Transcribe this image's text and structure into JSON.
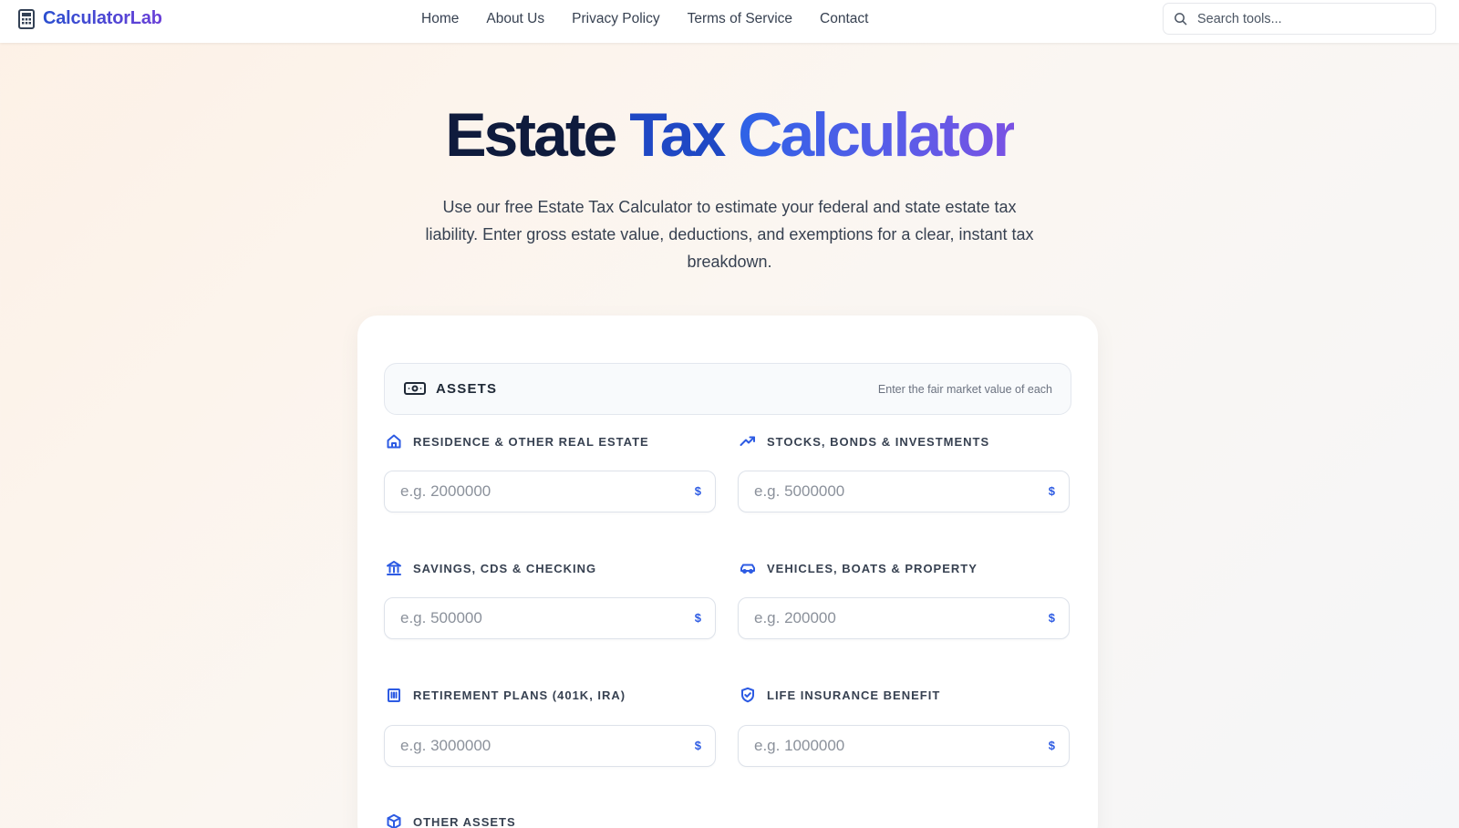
{
  "brand": {
    "name": "CalculatorLab",
    "logo_icon": "calculator-icon"
  },
  "nav": {
    "items": [
      {
        "label": "Home"
      },
      {
        "label": "About Us"
      },
      {
        "label": "Privacy Policy"
      },
      {
        "label": "Terms of Service"
      },
      {
        "label": "Contact"
      }
    ]
  },
  "search": {
    "placeholder": "Search tools...",
    "icon": "search-icon"
  },
  "hero": {
    "title_part1": "Estate",
    "title_part2": "Tax",
    "title_part3": "Calculator",
    "subtitle": "Use our free Estate Tax Calculator to estimate your federal and state estate tax liability. Enter gross estate value, deductions, and exemptions for a clear, instant tax breakdown."
  },
  "assets_section": {
    "title": "ASSETS",
    "hint": "Enter the fair market value of each",
    "icon": "cash-icon",
    "fields": [
      {
        "label": "RESIDENCE & OTHER REAL ESTATE",
        "placeholder": "e.g. 2000000",
        "currency": "$",
        "icon": "home-icon"
      },
      {
        "label": "STOCKS, BONDS & INVESTMENTS",
        "placeholder": "e.g. 5000000",
        "currency": "$",
        "icon": "trending-up-icon"
      },
      {
        "label": "SAVINGS, CDS & CHECKING",
        "placeholder": "e.g. 500000",
        "currency": "$",
        "icon": "bank-icon"
      },
      {
        "label": "VEHICLES, BOATS & PROPERTY",
        "placeholder": "e.g. 200000",
        "currency": "$",
        "icon": "car-icon"
      },
      {
        "label": "RETIREMENT PLANS (401K, IRA)",
        "placeholder": "e.g. 3000000",
        "currency": "$",
        "icon": "building-icon"
      },
      {
        "label": "LIFE INSURANCE BENEFIT",
        "placeholder": "e.g. 1000000",
        "currency": "$",
        "icon": "shield-check-icon"
      },
      {
        "label": "OTHER ASSETS",
        "icon": "box-icon"
      }
    ]
  },
  "colors": {
    "accent": "#2d5be3",
    "title_dark": "#0f1b3d",
    "title_blue": "#1f48c4",
    "title_purple": "#7a52e3"
  }
}
